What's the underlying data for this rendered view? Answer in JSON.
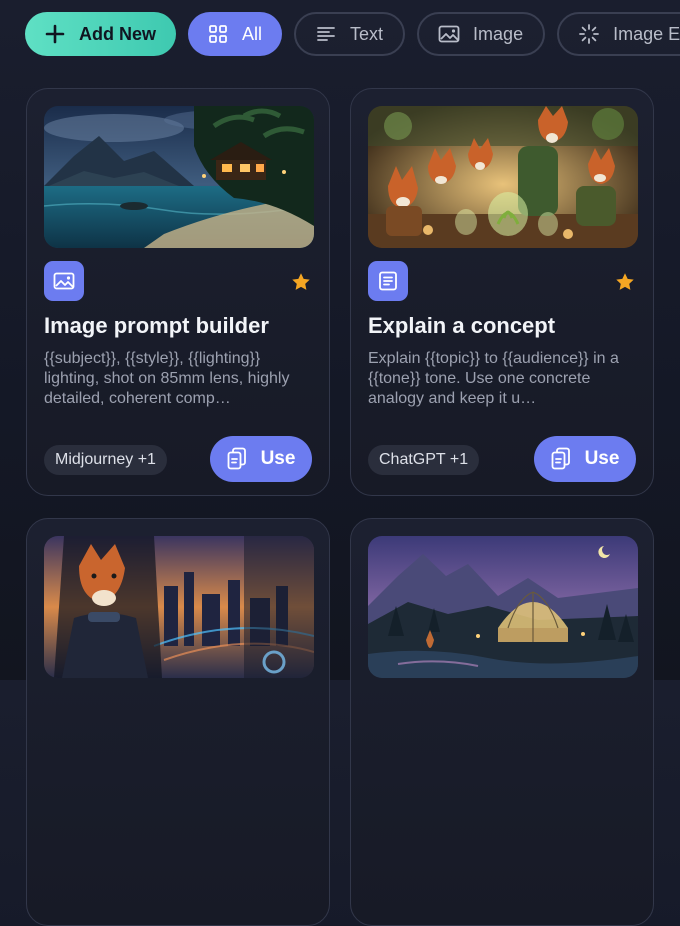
{
  "filters": {
    "add_label": "Add New",
    "all_label": "All",
    "text_label": "Text",
    "image_label": "Image",
    "image_edit_label": "Image Ed"
  },
  "colors": {
    "accent": "#6c7cf0",
    "add_gradient": "#4fd6bb",
    "star": "#f5a623"
  },
  "cards": [
    {
      "title": "Image prompt builder",
      "description": "{{subject}}, {{style}}, {{lighting}} lighting, shot on 85mm lens, highly detailed, coherent comp…",
      "type_icon": "image-icon",
      "favorite": true,
      "model_tag": "Midjourney +1",
      "use_label": "Use",
      "thumbnail": "tropical-beach-night"
    },
    {
      "title": "Explain a concept",
      "description": "Explain {{topic}} to {{audience}} in a {{tone}} tone. Use one concrete analogy and keep it u…",
      "type_icon": "text-icon",
      "favorite": true,
      "model_tag": "ChatGPT +1",
      "use_label": "Use",
      "thumbnail": "foxes-tea-party"
    },
    {
      "thumbnail": "fox-pilot-city"
    },
    {
      "thumbnail": "greenhouse-mountains"
    }
  ]
}
